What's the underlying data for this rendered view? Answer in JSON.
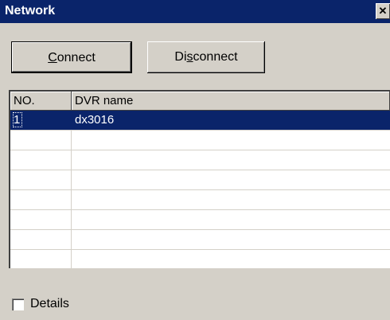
{
  "window": {
    "title": "Network",
    "close_glyph": "✕"
  },
  "toolbar": {
    "connect_label_prefix": "",
    "connect_label_mnemonic": "C",
    "connect_label_suffix": "onnect",
    "disconnect_label_prefix": "Di",
    "disconnect_label_mnemonic": "s",
    "disconnect_label_suffix": "connect"
  },
  "table": {
    "columns": [
      "NO.",
      "DVR name"
    ],
    "rows": [
      {
        "no": "1",
        "name": "dx3016",
        "selected": true
      },
      {
        "no": "",
        "name": ""
      },
      {
        "no": "",
        "name": ""
      },
      {
        "no": "",
        "name": ""
      },
      {
        "no": "",
        "name": ""
      },
      {
        "no": "",
        "name": ""
      },
      {
        "no": "",
        "name": ""
      },
      {
        "no": "",
        "name": ""
      }
    ]
  },
  "details": {
    "label": "Details",
    "checked": false
  },
  "colors": {
    "titlebar": "#0a246a",
    "selection": "#0a246a",
    "face": "#d4d0c8"
  }
}
